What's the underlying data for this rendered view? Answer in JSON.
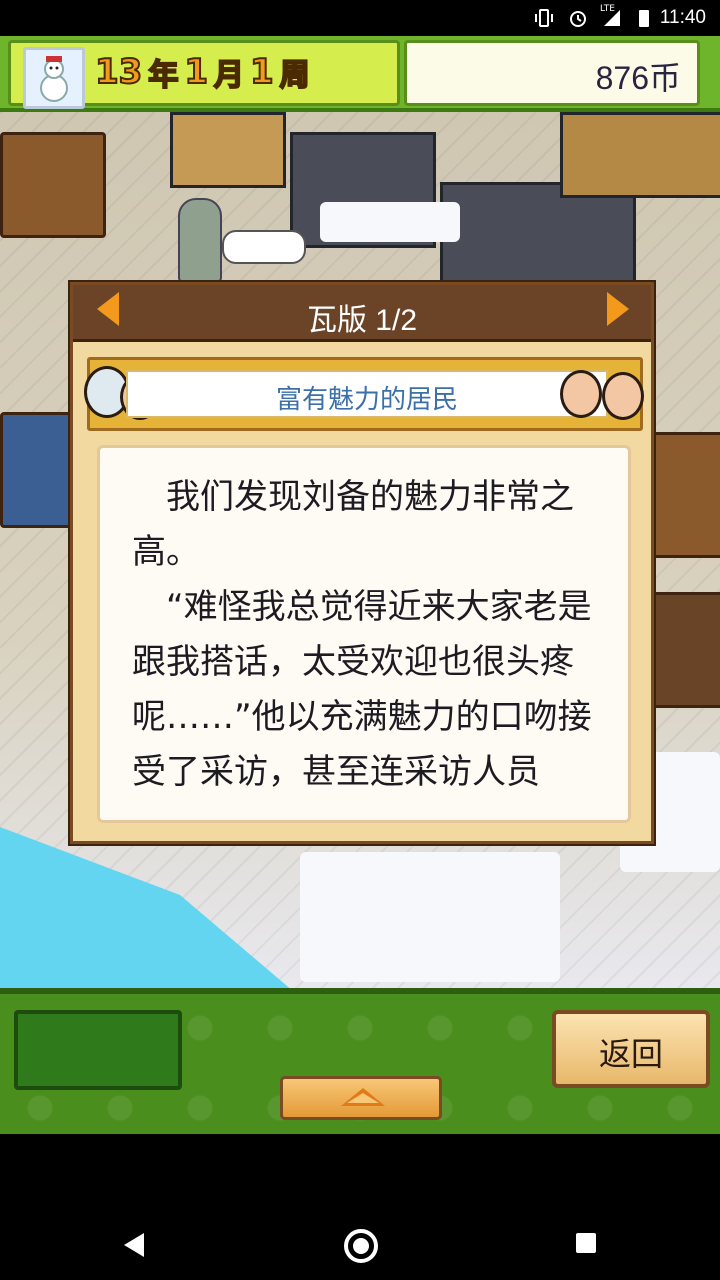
{
  "status_bar": {
    "time": "11:40",
    "network": "LTE",
    "icons": [
      "vibrate-icon",
      "alarm-icon",
      "signal-icon",
      "battery-icon"
    ]
  },
  "hud": {
    "year_num": "13",
    "year_unit": "年",
    "month_num": "1",
    "month_unit": "月",
    "week_num": "1",
    "week_unit": "周",
    "coins": "876币"
  },
  "dialog": {
    "title": "瓦版 1/2",
    "banner": "富有魅力的居民",
    "body": "　我们发现刘备的魅力非常之高。\n　“难怪我总觉得近来大家老是跟我搭话，太受欢迎也很头疼呢……”他以充满魅力的口吻接受了采访，甚至连采访人员"
  },
  "bottom": {
    "back_label": "返回"
  },
  "colors": {
    "accent_orange": "#f39a1d",
    "hud_green": "#6fb52b",
    "dialog_brown": "#6b4428",
    "banner_blue_text": "#3d6fa8"
  }
}
